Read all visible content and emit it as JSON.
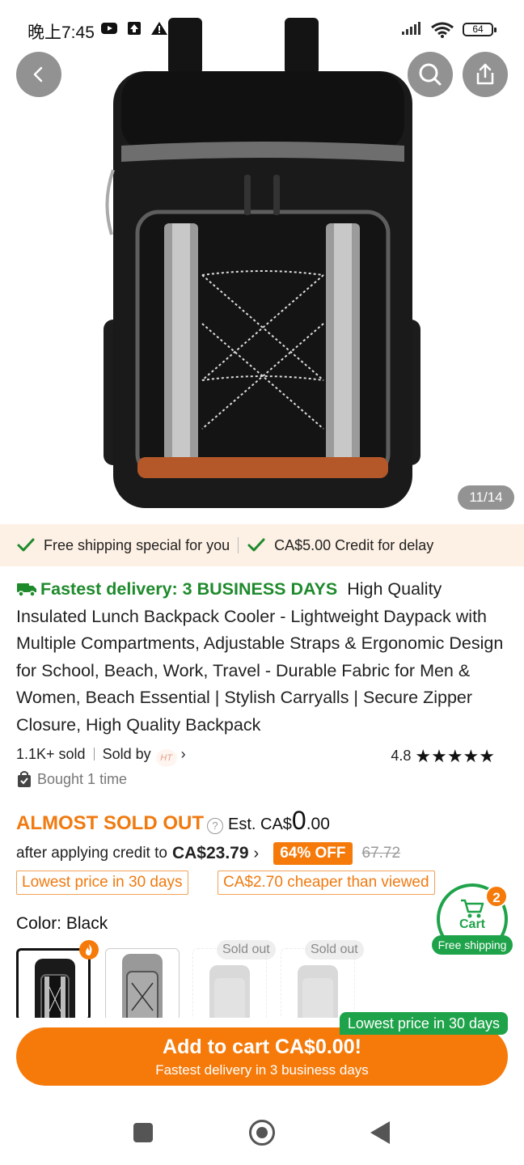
{
  "status_bar": {
    "time": "晚上7:45",
    "battery": "64",
    "icons": [
      "youtube-icon",
      "upload-icon",
      "warning-icon",
      "signal-icon",
      "wifi-icon",
      "battery-icon"
    ]
  },
  "header": {
    "back_icon": "chevron-left-icon",
    "search_icon": "search-icon",
    "share_icon": "share-icon"
  },
  "gallery": {
    "counter": "11/14"
  },
  "shipping_strip": {
    "free_shipping": "Free shipping special for you",
    "credit": "CA$5.00 Credit for delay"
  },
  "product": {
    "fastest_delivery": "Fastest delivery: 3 BUSINESS DAYS",
    "title": "High Quality Insulated Lunch Backpack Cooler - Lightweight Daypack with Multiple Compartments, Adjustable Straps & Ergonomic Design for School, Beach, Work, Travel - Durable Fabric for Men & Women, Beach Essential | Stylish Carryalls | Secure Zipper Closure, High Quality Backpack",
    "sold": "1.1K+ sold",
    "sold_by": "Sold by",
    "store_logo": "HT",
    "rating": "4.8",
    "stars": "★★★★★",
    "bought": "Bought 1 time"
  },
  "pricing": {
    "almost_sold_out": "ALMOST SOLD OUT",
    "help": "?",
    "est_prefix": "Est. CA$",
    "est_whole": "0",
    "est_cents": ".00",
    "after_credit": "after applying credit to",
    "credit_price": "CA$23.79",
    "discount": "64% OFF",
    "original_price": "67.72",
    "badge_lowest": "Lowest price in 30 days",
    "badge_cheaper": "CA$2.70 cheaper than viewed"
  },
  "variants": {
    "label": "Color: Black",
    "sold_out_label": "Sold out"
  },
  "cart_float": {
    "label": "Cart",
    "count": "2",
    "free_shipping": "Free shipping"
  },
  "bottom": {
    "lowest_badge": "Lowest price in 30 days",
    "add_to_cart": "Add to cart CA$0.00!",
    "delivery_note": "Fastest delivery in 3 business days"
  },
  "colors": {
    "orange": "#f57a0a",
    "green": "#1fa34a",
    "strip_bg": "#fdf0e4"
  }
}
